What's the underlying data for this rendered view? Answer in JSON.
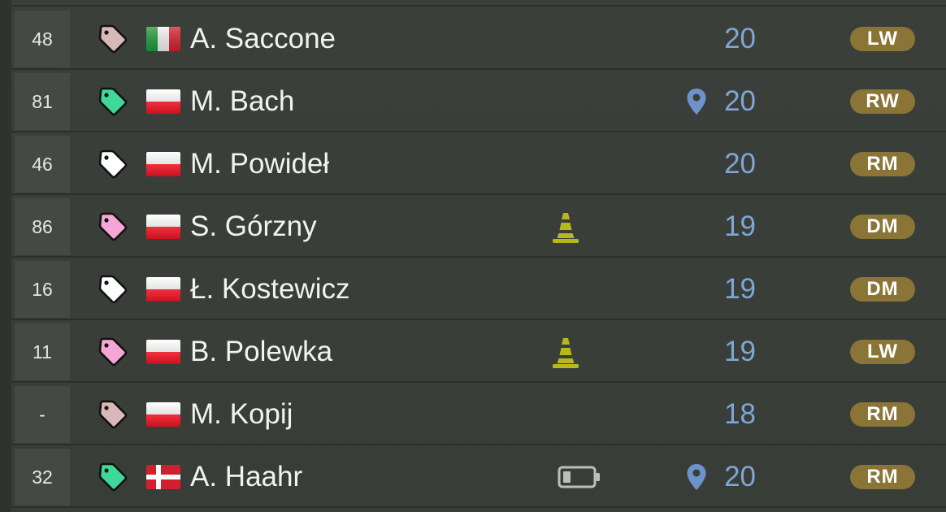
{
  "colors": {
    "background": "#3a3e39",
    "number_cell": "#444943",
    "age_text": "#7fa6d6",
    "position_badge": "#8b7536",
    "tag_rose": "#d8b8b8",
    "tag_green": "#3ed99a",
    "tag_white": "#ffffff",
    "tag_pink": "#f5a6d6",
    "cone": "#b6b81c",
    "pin": "#6d92cc"
  },
  "players": [
    {
      "number": "48",
      "tag_color": "rose",
      "tag_icon": "tag-icon",
      "flag": "italy",
      "name": "A. Saccone",
      "status_icon": "",
      "location_icon": false,
      "age": "20",
      "position": "LW"
    },
    {
      "number": "81",
      "tag_color": "green",
      "tag_icon": "tag-icon",
      "flag": "poland",
      "name": "M. Bach",
      "status_icon": "",
      "location_icon": true,
      "age": "20",
      "position": "RW"
    },
    {
      "number": "46",
      "tag_color": "white",
      "tag_icon": "tag-icon",
      "flag": "poland",
      "name": "M. Powideł",
      "status_icon": "",
      "location_icon": false,
      "age": "20",
      "position": "RM"
    },
    {
      "number": "86",
      "tag_color": "pink",
      "tag_icon": "tag-icon",
      "flag": "poland",
      "name": "S. Górzny",
      "status_icon": "cone-icon",
      "location_icon": false,
      "age": "19",
      "position": "DM"
    },
    {
      "number": "16",
      "tag_color": "white",
      "tag_icon": "tag-icon",
      "flag": "poland",
      "name": "Ł. Kostewicz",
      "status_icon": "",
      "location_icon": false,
      "age": "19",
      "position": "DM"
    },
    {
      "number": "11",
      "tag_color": "pink",
      "tag_icon": "tag-icon",
      "flag": "poland",
      "name": "B. Polewka",
      "status_icon": "cone-icon",
      "location_icon": false,
      "age": "19",
      "position": "LW"
    },
    {
      "number": "-",
      "tag_color": "rose",
      "tag_icon": "tag-icon",
      "flag": "poland",
      "name": "M. Kopij",
      "status_icon": "",
      "location_icon": false,
      "age": "18",
      "position": "RM"
    },
    {
      "number": "32",
      "tag_color": "green",
      "tag_icon": "tag-icon",
      "flag": "denmark",
      "name": "A. Haahr",
      "status_icon": "battery-icon",
      "location_icon": true,
      "age": "20",
      "position": "RM"
    }
  ]
}
